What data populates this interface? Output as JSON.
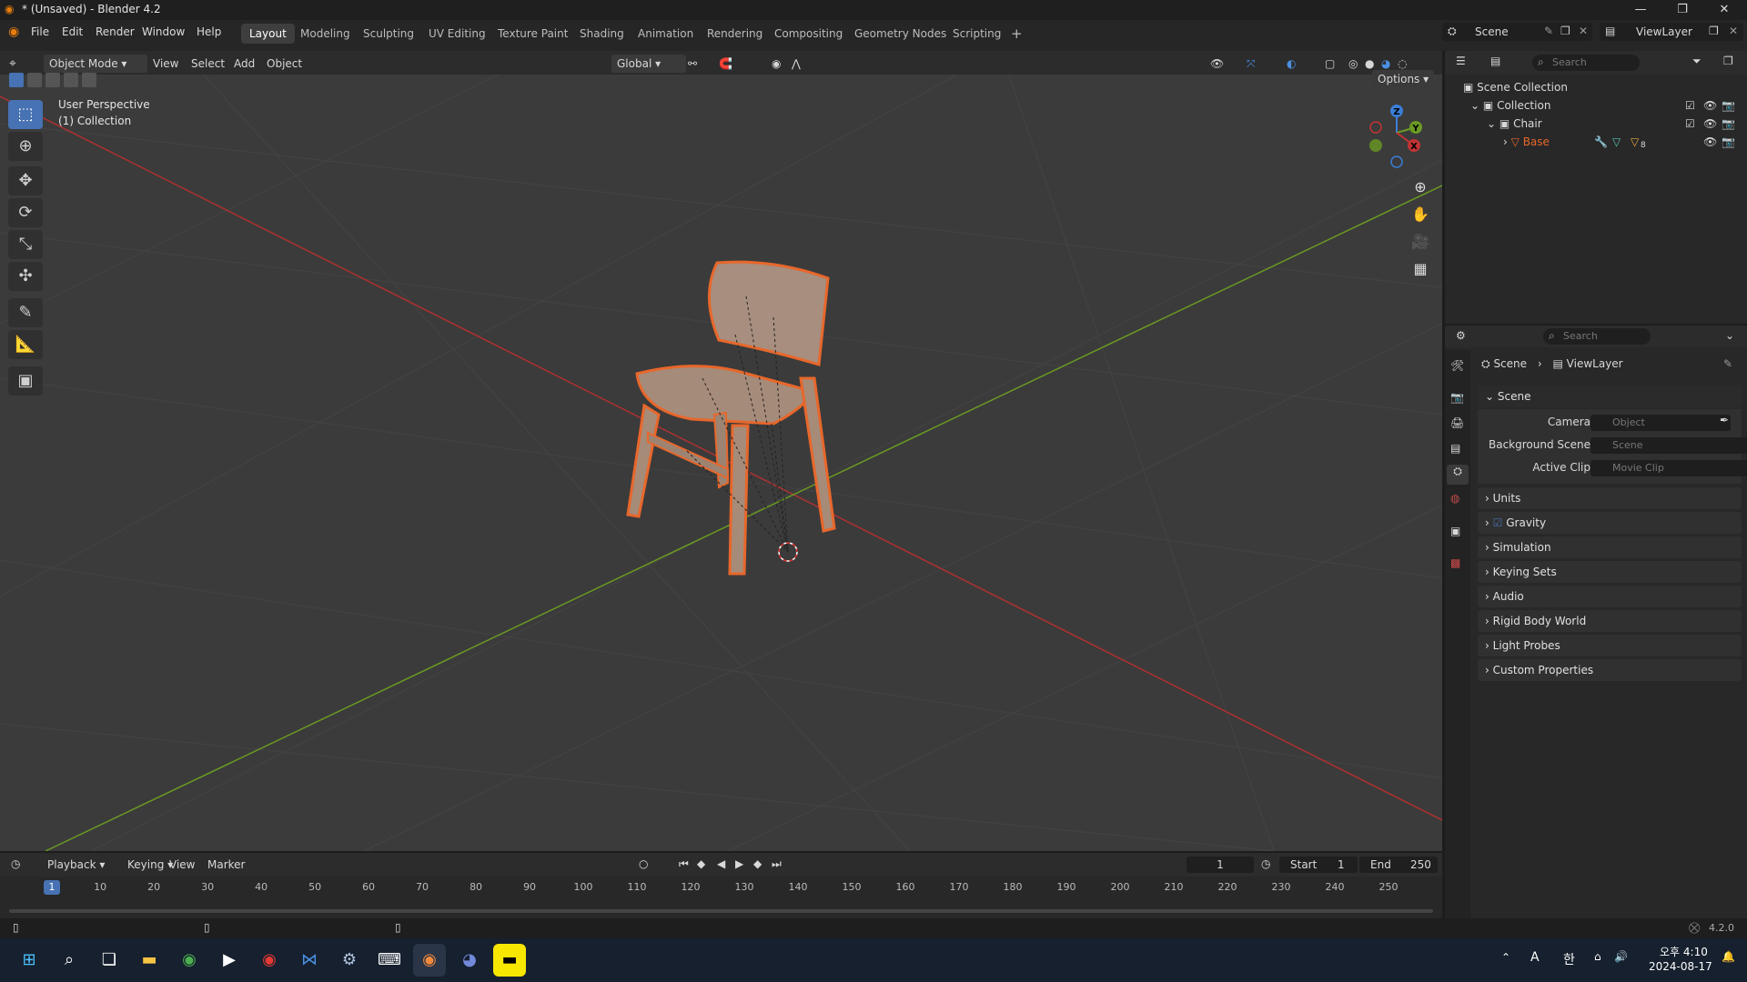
{
  "window": {
    "title": "* (Unsaved) - Blender 4.2",
    "min": "—",
    "max": "❐",
    "close": "✕"
  },
  "menu": [
    "File",
    "Edit",
    "Render",
    "Window",
    "Help"
  ],
  "workspaces": [
    "Layout",
    "Modeling",
    "Sculpting",
    "UV Editing",
    "Texture Paint",
    "Shading",
    "Animation",
    "Rendering",
    "Compositing",
    "Geometry Nodes",
    "Scripting"
  ],
  "workspace_add": "+",
  "scene_selector": {
    "scene": "Scene",
    "view_layer": "ViewLayer"
  },
  "viewport_header": {
    "mode": "Object Mode",
    "view": "View",
    "select": "Select",
    "add": "Add",
    "object": "Object",
    "transform": "Global",
    "options": "Options"
  },
  "viewport": {
    "perspective": "User Perspective",
    "collection": "(1) Collection"
  },
  "gizmo": {
    "z": "Z",
    "y": "Y",
    "x": "X"
  },
  "outliner": {
    "search_placeholder": "Search",
    "items": {
      "scene_collection": "Scene Collection",
      "collection": "Collection",
      "chair": "Chair",
      "base": "Base",
      "modifier_count": "8"
    }
  },
  "properties": {
    "search_placeholder": "Search",
    "breadcrumb": {
      "scene": "Scene",
      "view_layer": "ViewLayer"
    },
    "scene_panel": "Scene",
    "camera_label": "Camera",
    "camera_value": "Object",
    "bg_label": "Background Scene",
    "bg_value": "Scene",
    "clip_label": "Active Clip",
    "clip_value": "Movie Clip",
    "panels": [
      "Units",
      "Gravity",
      "Simulation",
      "Keying Sets",
      "Audio",
      "Rigid Body World",
      "Light Probes",
      "Custom Properties"
    ]
  },
  "timeline": {
    "playback": "Playback",
    "keying": "Keying",
    "view": "View",
    "marker": "Marker",
    "current_frame": "1",
    "start_label": "Start",
    "start": "1",
    "end_label": "End",
    "end": "250",
    "ticks": [
      "1",
      "10",
      "20",
      "30",
      "40",
      "50",
      "60",
      "70",
      "80",
      "90",
      "100",
      "110",
      "120",
      "130",
      "140",
      "150",
      "160",
      "170",
      "180",
      "190",
      "200",
      "210",
      "220",
      "230",
      "240",
      "250"
    ]
  },
  "status_bar": {
    "version": "4.2.0"
  },
  "taskbar": {
    "ime": "A",
    "lang": "한",
    "time": "오후 4:10",
    "date": "2024-08-17"
  },
  "colors": {
    "accent": "#4772b3",
    "selection": "#e8672b",
    "x_axis": "#c23434",
    "y_axis": "#6a9a23",
    "z_axis": "#3a7ed6"
  }
}
